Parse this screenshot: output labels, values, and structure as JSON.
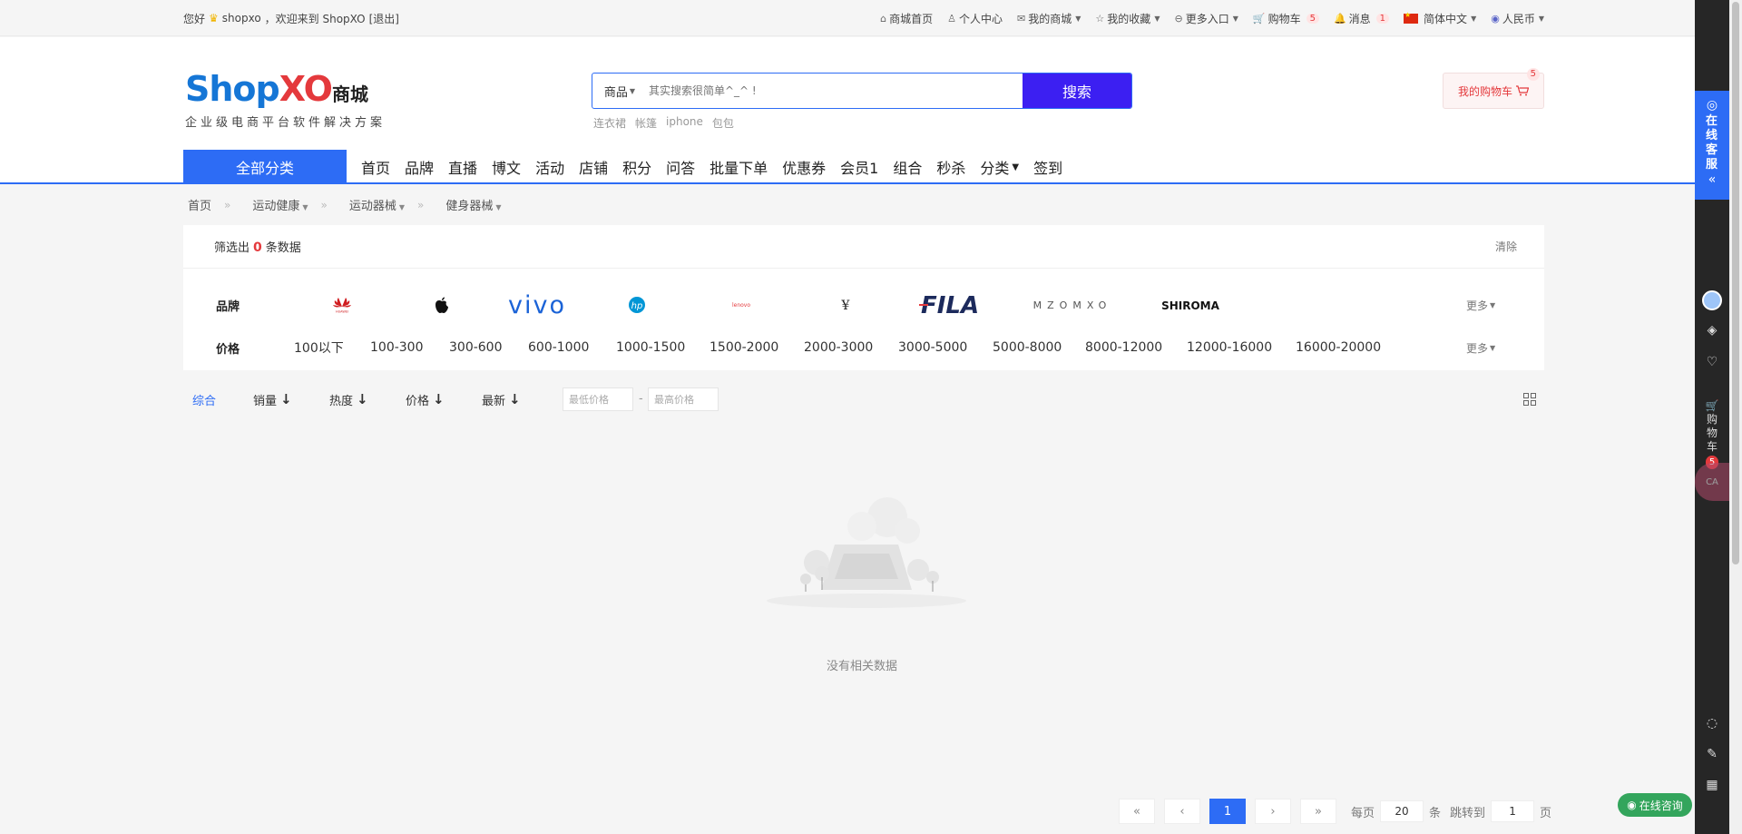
{
  "topbar": {
    "greeting": "您好",
    "username": "shopxo",
    "welcome": "，欢迎来到 ShopXO",
    "logout": "[退出]",
    "nav": {
      "home": "商城首页",
      "user_center": "个人中心",
      "my_mall": "我的商城",
      "favorites": "我的收藏",
      "more_entry": "更多入口",
      "cart": "购物车",
      "cart_count": "5",
      "messages": "消息",
      "message_count": "1",
      "language": "简体中文",
      "currency": "人民币"
    }
  },
  "logo": {
    "shop": "Shop",
    "xo": "XO",
    "mall": "商城",
    "slogan": "企业级电商平台软件解决方案"
  },
  "search": {
    "category": "商品",
    "placeholder": "其实搜索很简单^_^ !",
    "button": "搜索",
    "hotwords": [
      "连衣裙",
      "帐篷",
      "iphone",
      "包包"
    ]
  },
  "minicart": {
    "label": "我的购物车",
    "count": "5"
  },
  "mainnav": {
    "all_categories": "全部分类",
    "items": [
      "首页",
      "品牌",
      "直播",
      "博文",
      "活动",
      "店铺",
      "积分",
      "问答",
      "批量下单",
      "优惠券",
      "会员1",
      "组合",
      "秒杀",
      "分类",
      "签到"
    ]
  },
  "breadcrumb": {
    "items": [
      "首页",
      "运动健康",
      "运动器械",
      "健身器械"
    ],
    "separator": "»"
  },
  "filter": {
    "result_prefix": "筛选出",
    "result_count": "0",
    "result_suffix": "条数据",
    "clear": "清除",
    "brand_label": "品牌",
    "price_label": "价格",
    "more": "更多",
    "brands": [
      {
        "name": "HUAWEI",
        "icon": "huawei-logo"
      },
      {
        "name": "Apple",
        "icon": "apple-logo"
      },
      {
        "name": "vivo",
        "icon": "vivo-logo"
      },
      {
        "name": "hp",
        "icon": "hp-logo"
      },
      {
        "name": "lenovo",
        "icon": "lenovo-logo"
      },
      {
        "name": "YSL",
        "icon": "ysl-logo"
      },
      {
        "name": "FILA",
        "icon": "fila-logo"
      },
      {
        "name": "M Z O M X O",
        "icon": "mzomxo-logo"
      },
      {
        "name": "SHIROMA",
        "icon": "shiroma-logo"
      }
    ],
    "prices": [
      "100以下",
      "100-300",
      "300-600",
      "600-1000",
      "1000-1500",
      "1500-2000",
      "2000-3000",
      "3000-5000",
      "5000-8000",
      "8000-12000",
      "12000-16000",
      "16000-20000"
    ]
  },
  "sort": {
    "comprehensive": "综合",
    "sales": "销量",
    "popularity": "热度",
    "price": "价格",
    "newest": "最新",
    "min_price_placeholder": "最低价格",
    "max_price_placeholder": "最高价格",
    "dash": "-"
  },
  "empty": {
    "text": "没有相关数据"
  },
  "pager": {
    "first": "«",
    "prev": "‹",
    "current": "1",
    "next": "›",
    "last": "»",
    "per_page_label": "每页",
    "per_page": "20",
    "per_page_unit": "条",
    "jump_label": "跳转到",
    "jump_page": "1",
    "page_unit": "页"
  },
  "sidebar": {
    "service": "在线客服",
    "cart": "购物车",
    "cart_count": "5",
    "ca": "CA"
  },
  "consult": {
    "label": "在线咨询"
  },
  "colors": {
    "accent": "#2d6cf5",
    "search_button": "#3c1ff2",
    "price_red": "#e4393c"
  }
}
